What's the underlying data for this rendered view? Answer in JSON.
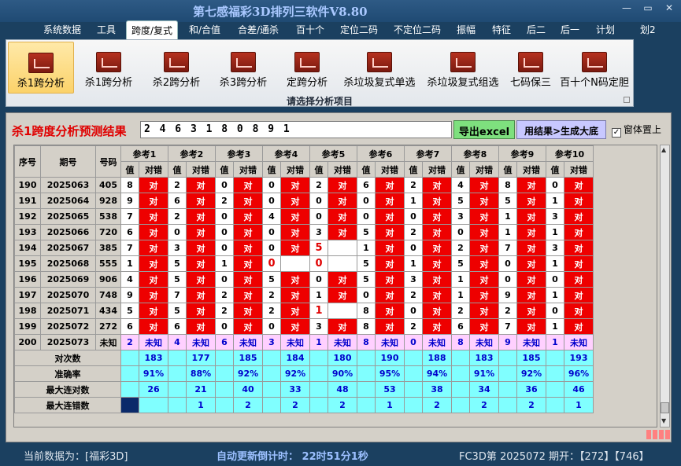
{
  "window": {
    "title": "第七感福彩3D排列三软件V8.80",
    "minimize": "—",
    "restore": "▭",
    "close": "✕"
  },
  "menu": [
    "系统数据",
    "工具",
    "跨度/复式",
    "和/合值",
    "合差/通杀",
    "百十个",
    "定位二码",
    "不定位二码",
    "振幅",
    "特征",
    "后二",
    "后一",
    "计划",
    "划2"
  ],
  "ribbon": {
    "buttons": [
      "杀1跨分析",
      "杀1跨分析",
      "杀2跨分析",
      "杀3跨分析",
      "定跨分析",
      "杀垃圾复式单选",
      "杀垃圾复式组选",
      "七码保三",
      "百十个N码定胆"
    ],
    "selected_index": 0,
    "group_label": "请选择分析项目"
  },
  "result": {
    "label": "杀1跨度分析预测结果",
    "value": "2 4 6 3 1 8 0 8 9 1",
    "export_btn": "导出excel",
    "gen_btn": "用结果>生成大底",
    "topmost_label": "窗体置上",
    "topmost_checked": "✓"
  },
  "table": {
    "headers": {
      "seq": "序号",
      "period": "期号",
      "number": "号码",
      "value": "值",
      "result": "对错"
    },
    "refs": [
      "参考1",
      "参考2",
      "参考3",
      "参考4",
      "参考5",
      "参考6",
      "参考7",
      "参考8",
      "参考9",
      "参考10"
    ],
    "right_mark": "对",
    "unknown": "未知",
    "rows": [
      {
        "seq": "190",
        "period": "2025063",
        "num": "405",
        "cells": [
          [
            "8",
            "r"
          ],
          [
            "2",
            "r"
          ],
          [
            "0",
            "r"
          ],
          [
            "0",
            "r"
          ],
          [
            "2",
            "r"
          ],
          [
            "6",
            "r"
          ],
          [
            "2",
            "r"
          ],
          [
            "4",
            "r"
          ],
          [
            "8",
            "r"
          ],
          [
            "0",
            "r"
          ]
        ]
      },
      {
        "seq": "191",
        "period": "2025064",
        "num": "928",
        "cells": [
          [
            "9",
            "r"
          ],
          [
            "6",
            "r"
          ],
          [
            "2",
            "r"
          ],
          [
            "0",
            "r"
          ],
          [
            "0",
            "r"
          ],
          [
            "0",
            "r"
          ],
          [
            "1",
            "r"
          ],
          [
            "5",
            "r"
          ],
          [
            "5",
            "r"
          ],
          [
            "1",
            "r"
          ]
        ]
      },
      {
        "seq": "192",
        "period": "2025065",
        "num": "538",
        "cells": [
          [
            "7",
            "r"
          ],
          [
            "2",
            "r"
          ],
          [
            "0",
            "r"
          ],
          [
            "4",
            "r"
          ],
          [
            "0",
            "r"
          ],
          [
            "0",
            "r"
          ],
          [
            "0",
            "r"
          ],
          [
            "3",
            "r"
          ],
          [
            "1",
            "r"
          ],
          [
            "3",
            "r"
          ]
        ]
      },
      {
        "seq": "193",
        "period": "2025066",
        "num": "720",
        "cells": [
          [
            "6",
            "r"
          ],
          [
            "0",
            "r"
          ],
          [
            "0",
            "r"
          ],
          [
            "0",
            "r"
          ],
          [
            "3",
            "r"
          ],
          [
            "5",
            "r"
          ],
          [
            "2",
            "r"
          ],
          [
            "0",
            "r"
          ],
          [
            "1",
            "r"
          ],
          [
            "1",
            "r"
          ]
        ]
      },
      {
        "seq": "194",
        "period": "2025067",
        "num": "385",
        "cells": [
          [
            "7",
            "r"
          ],
          [
            "3",
            "r"
          ],
          [
            "0",
            "r"
          ],
          [
            "0",
            "r"
          ],
          [
            "5",
            "w"
          ],
          [
            "1",
            "r"
          ],
          [
            "0",
            "r"
          ],
          [
            "2",
            "r"
          ],
          [
            "7",
            "r"
          ],
          [
            "3",
            "r"
          ]
        ]
      },
      {
        "seq": "195",
        "period": "2025068",
        "num": "555",
        "cells": [
          [
            "1",
            "r"
          ],
          [
            "5",
            "r"
          ],
          [
            "1",
            "r"
          ],
          [
            "0",
            "w"
          ],
          [
            "0",
            "w"
          ],
          [
            "5",
            "r"
          ],
          [
            "1",
            "r"
          ],
          [
            "5",
            "r"
          ],
          [
            "0",
            "r"
          ],
          [
            "1",
            "r"
          ]
        ]
      },
      {
        "seq": "196",
        "period": "2025069",
        "num": "906",
        "cells": [
          [
            "4",
            "r"
          ],
          [
            "5",
            "r"
          ],
          [
            "0",
            "r"
          ],
          [
            "5",
            "r"
          ],
          [
            "0",
            "r"
          ],
          [
            "5",
            "r"
          ],
          [
            "3",
            "r"
          ],
          [
            "1",
            "r"
          ],
          [
            "0",
            "r"
          ],
          [
            "0",
            "r"
          ]
        ]
      },
      {
        "seq": "197",
        "period": "2025070",
        "num": "748",
        "cells": [
          [
            "9",
            "r"
          ],
          [
            "7",
            "r"
          ],
          [
            "2",
            "r"
          ],
          [
            "2",
            "r"
          ],
          [
            "1",
            "r"
          ],
          [
            "0",
            "r"
          ],
          [
            "2",
            "r"
          ],
          [
            "1",
            "r"
          ],
          [
            "9",
            "r"
          ],
          [
            "1",
            "r"
          ]
        ]
      },
      {
        "seq": "198",
        "period": "2025071",
        "num": "434",
        "cells": [
          [
            "5",
            "r"
          ],
          [
            "5",
            "r"
          ],
          [
            "2",
            "r"
          ],
          [
            "2",
            "r"
          ],
          [
            "1",
            "w"
          ],
          [
            "8",
            "r"
          ],
          [
            "0",
            "r"
          ],
          [
            "2",
            "r"
          ],
          [
            "2",
            "r"
          ],
          [
            "0",
            "r"
          ]
        ]
      },
      {
        "seq": "199",
        "period": "2025072",
        "num": "272",
        "cells": [
          [
            "6",
            "r"
          ],
          [
            "6",
            "r"
          ],
          [
            "0",
            "r"
          ],
          [
            "0",
            "r"
          ],
          [
            "3",
            "r"
          ],
          [
            "8",
            "r"
          ],
          [
            "2",
            "r"
          ],
          [
            "6",
            "r"
          ],
          [
            "7",
            "r"
          ],
          [
            "1",
            "r"
          ]
        ]
      }
    ],
    "pending": {
      "seq": "200",
      "period": "2025073",
      "num": "未知",
      "values": [
        "2",
        "4",
        "6",
        "3",
        "1",
        "8",
        "0",
        "8",
        "9",
        "1"
      ]
    },
    "stats": [
      {
        "label": "对次数",
        "values": [
          "183",
          "177",
          "185",
          "184",
          "180",
          "190",
          "188",
          "183",
          "185",
          "193"
        ]
      },
      {
        "label": "准确率",
        "values": [
          "91%",
          "88%",
          "92%",
          "92%",
          "90%",
          "95%",
          "94%",
          "91%",
          "92%",
          "96%"
        ]
      },
      {
        "label": "最大连对数",
        "values": [
          "26",
          "21",
          "40",
          "33",
          "48",
          "53",
          "38",
          "34",
          "36",
          "46"
        ]
      },
      {
        "label": "最大连错数",
        "values": [
          "",
          "1",
          "2",
          "2",
          "2",
          "1",
          "2",
          "2",
          "2",
          "1"
        ]
      }
    ]
  },
  "status": {
    "current": "当前数据为：[福彩3D]",
    "countdown": "自动更新倒计时：  22时51分1秒",
    "draw": "FC3D第 2025072 期开：【272】【746】"
  }
}
